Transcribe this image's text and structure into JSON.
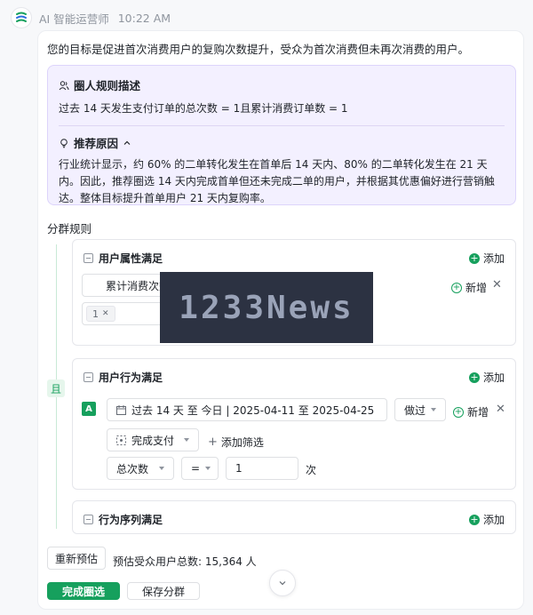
{
  "header": {
    "name": "AI 智能运营师",
    "time": "10:22 AM"
  },
  "intro": "您的目标是促进首次消费用户的复购次数提升，受众为首次消费但未再次消费的用户。",
  "rule_box": {
    "desc_title": "圈人规则描述",
    "desc_text": "过去 14 天发生支付订单的总次数 = 1且累计消费订单数 = 1",
    "reason_title": "推荐原因",
    "reason_text": "行业统计显示，约 60% 的二单转化发生在首单后 14 天内、80% 的二单转化发生在 21 天内。因此，推荐圈选 14 天内完成首单但还未完成二单的用户，并根据其优惠偏好进行营销触达。整体目标提升首单用户 21 天内复购率。"
  },
  "section_label": "分群规则",
  "and_label": "且",
  "group_attr": {
    "title": "用户属性满足",
    "add": "添加",
    "field": "累计消费次数",
    "new": "新增",
    "tag": "1"
  },
  "group_behavior": {
    "title": "用户行为满足",
    "add": "添加",
    "badge": "A",
    "date_range": "过去 14 天 至 今日 | 2025-04-11 至 2025-04-25",
    "action": "做过",
    "new": "新增",
    "event": "完成支付",
    "add_filter": "添加筛选",
    "metric": "总次数",
    "operator": "=",
    "value": "1",
    "unit": "次"
  },
  "group_sequence": {
    "title": "行为序列满足",
    "add": "添加"
  },
  "watermark": "1233News",
  "footer": {
    "re_estimate": "重新预估",
    "estimate_text": "预估受众用户总数: 15,364 人",
    "complete": "完成圈选",
    "save": "保存分群"
  },
  "colors": {
    "accent": "#16a05d",
    "purple_bg": "#f3f0ff"
  }
}
